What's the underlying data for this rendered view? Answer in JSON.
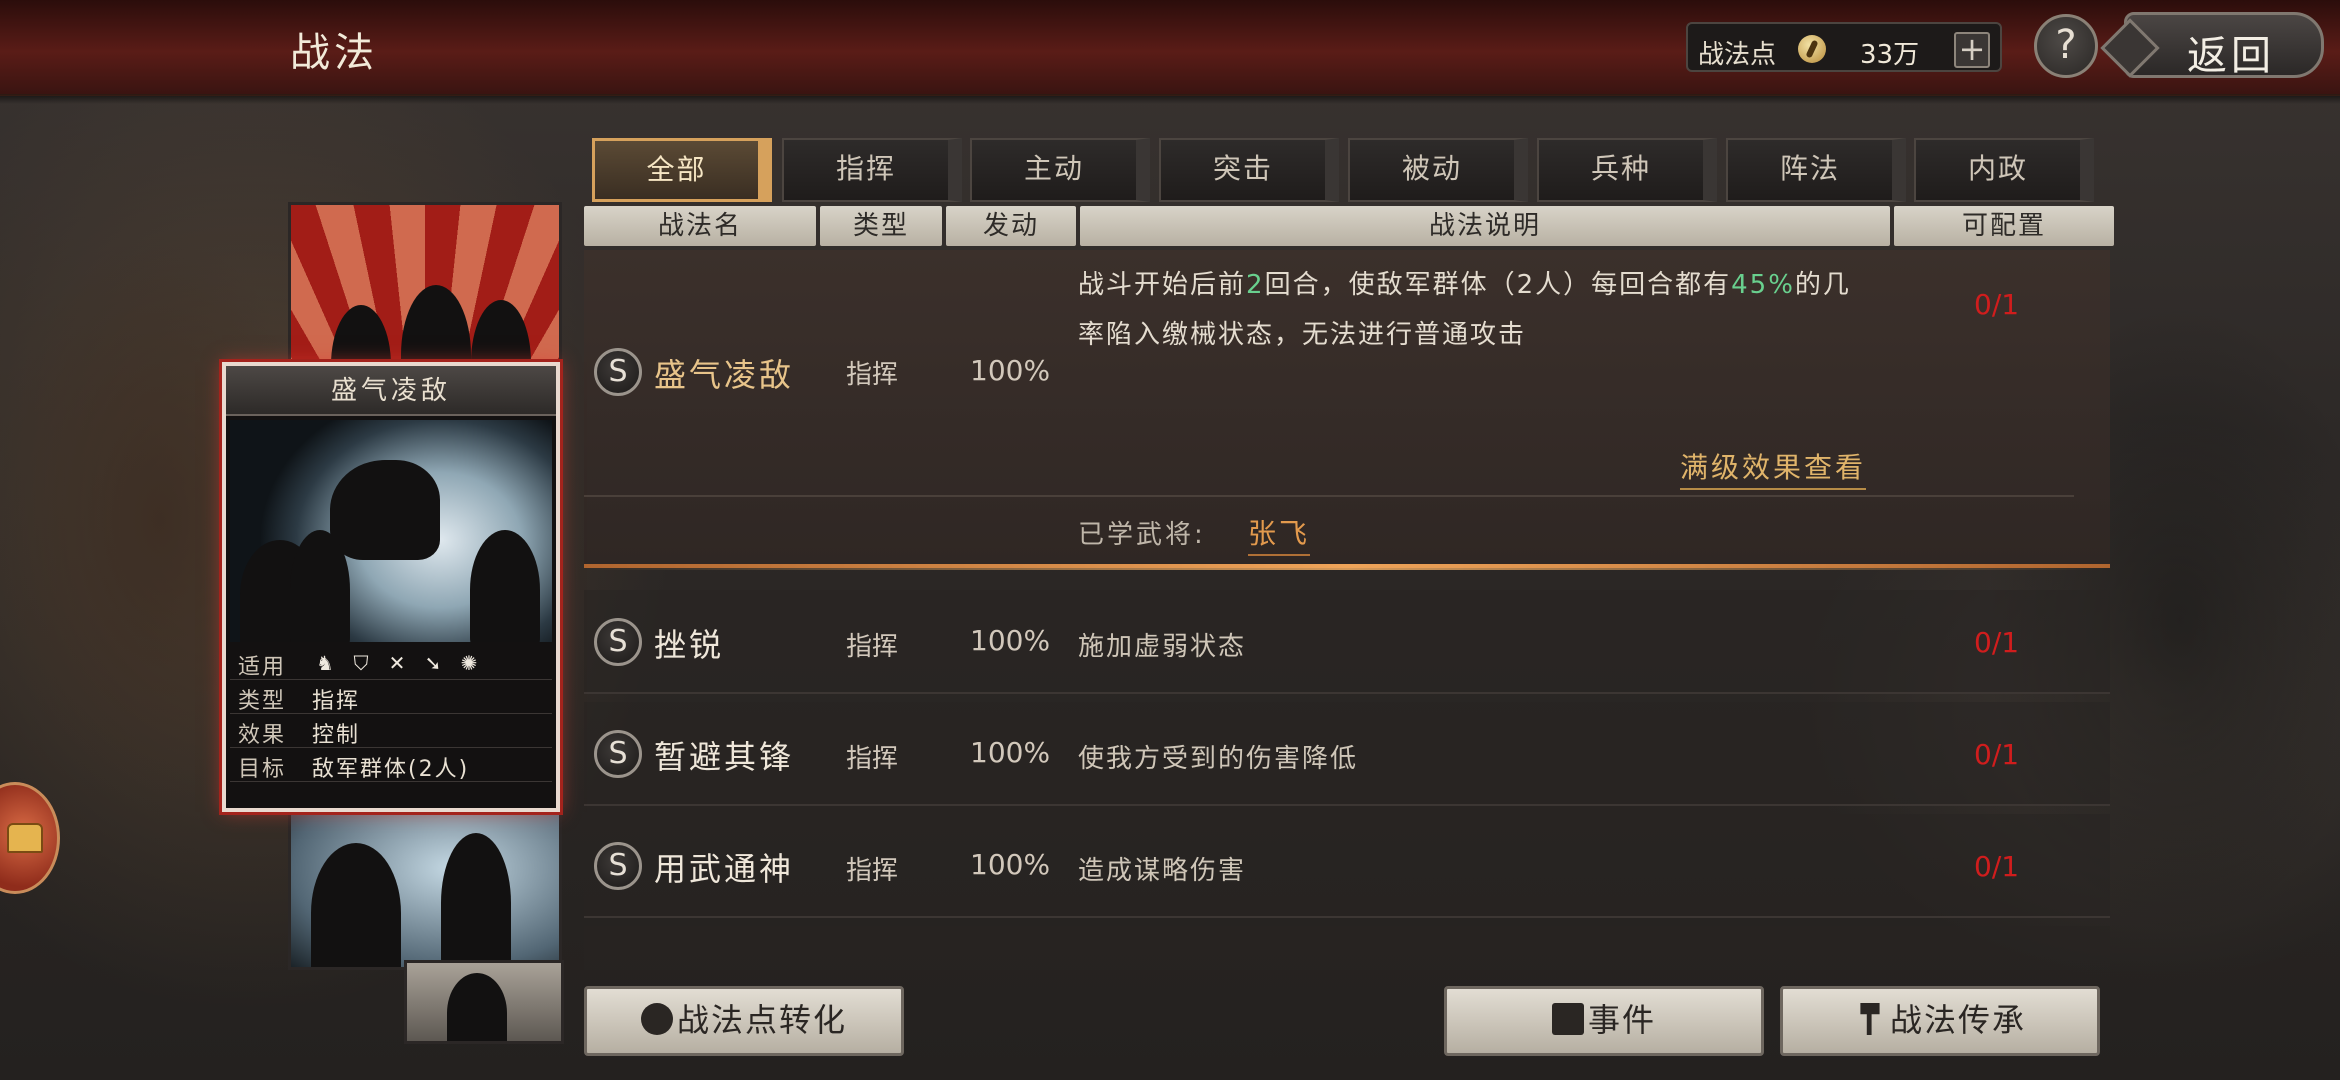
{
  "header": {
    "title": "战法",
    "points_label": "战法点",
    "points_icon": "coin-icon",
    "points_value": "33万",
    "add_label": "+",
    "help_label": "?",
    "back_label": "返回"
  },
  "tabs": [
    {
      "label": "全部",
      "active": true
    },
    {
      "label": "指挥"
    },
    {
      "label": "主动"
    },
    {
      "label": "突击"
    },
    {
      "label": "被动"
    },
    {
      "label": "兵种"
    },
    {
      "label": "阵法"
    },
    {
      "label": "内政"
    }
  ],
  "table": {
    "headers": [
      "战法名",
      "类型",
      "发动",
      "战法说明",
      "可配置"
    ]
  },
  "expanded": {
    "grade": "S",
    "name": "盛气凌敌",
    "type": "指挥",
    "rate": "100%",
    "desc_part1": "战斗开始后前",
    "desc_num1": "2",
    "desc_part2": "回合，使敌军群体（2人）每回合都有",
    "desc_num2": "45%",
    "desc_part3": "的几率陷入缴械状态，无法进行普通攻击",
    "config": "0/1",
    "more_label": "满级效果查看",
    "learned_label": "已学武将:",
    "learned_name": "张飞"
  },
  "rows": [
    {
      "grade": "S",
      "name": "挫锐",
      "type": "指挥",
      "rate": "100%",
      "desc": "施加虚弱状态",
      "config": "0/1"
    },
    {
      "grade": "S",
      "name": "暂避其锋",
      "type": "指挥",
      "rate": "100%",
      "desc": "使我方受到的伤害降低",
      "config": "0/1"
    },
    {
      "grade": "S",
      "name": "用武通神",
      "type": "指挥",
      "rate": "100%",
      "desc": "造成谋略伤害",
      "config": "0/1"
    }
  ],
  "card": {
    "title": "盛气凌敌",
    "applicable_key": "适用",
    "unit_icons": [
      "cavalry-icon",
      "shield-icon",
      "bow-icon",
      "spear-icon",
      "siege-icon"
    ],
    "type_key": "类型",
    "type_val": "指挥",
    "effect_key": "效果",
    "effect_val": "控制",
    "target_key": "目标",
    "target_val": "敌军群体(2人)"
  },
  "buttons": {
    "convert": "战法点转化",
    "events": "事件",
    "inherit": "战法传承"
  },
  "colors": {
    "accent_gold": "#e8c48a",
    "highlight_green": "#69d08e",
    "config_red": "#d01d1d",
    "header_red": "#5a1c17"
  }
}
